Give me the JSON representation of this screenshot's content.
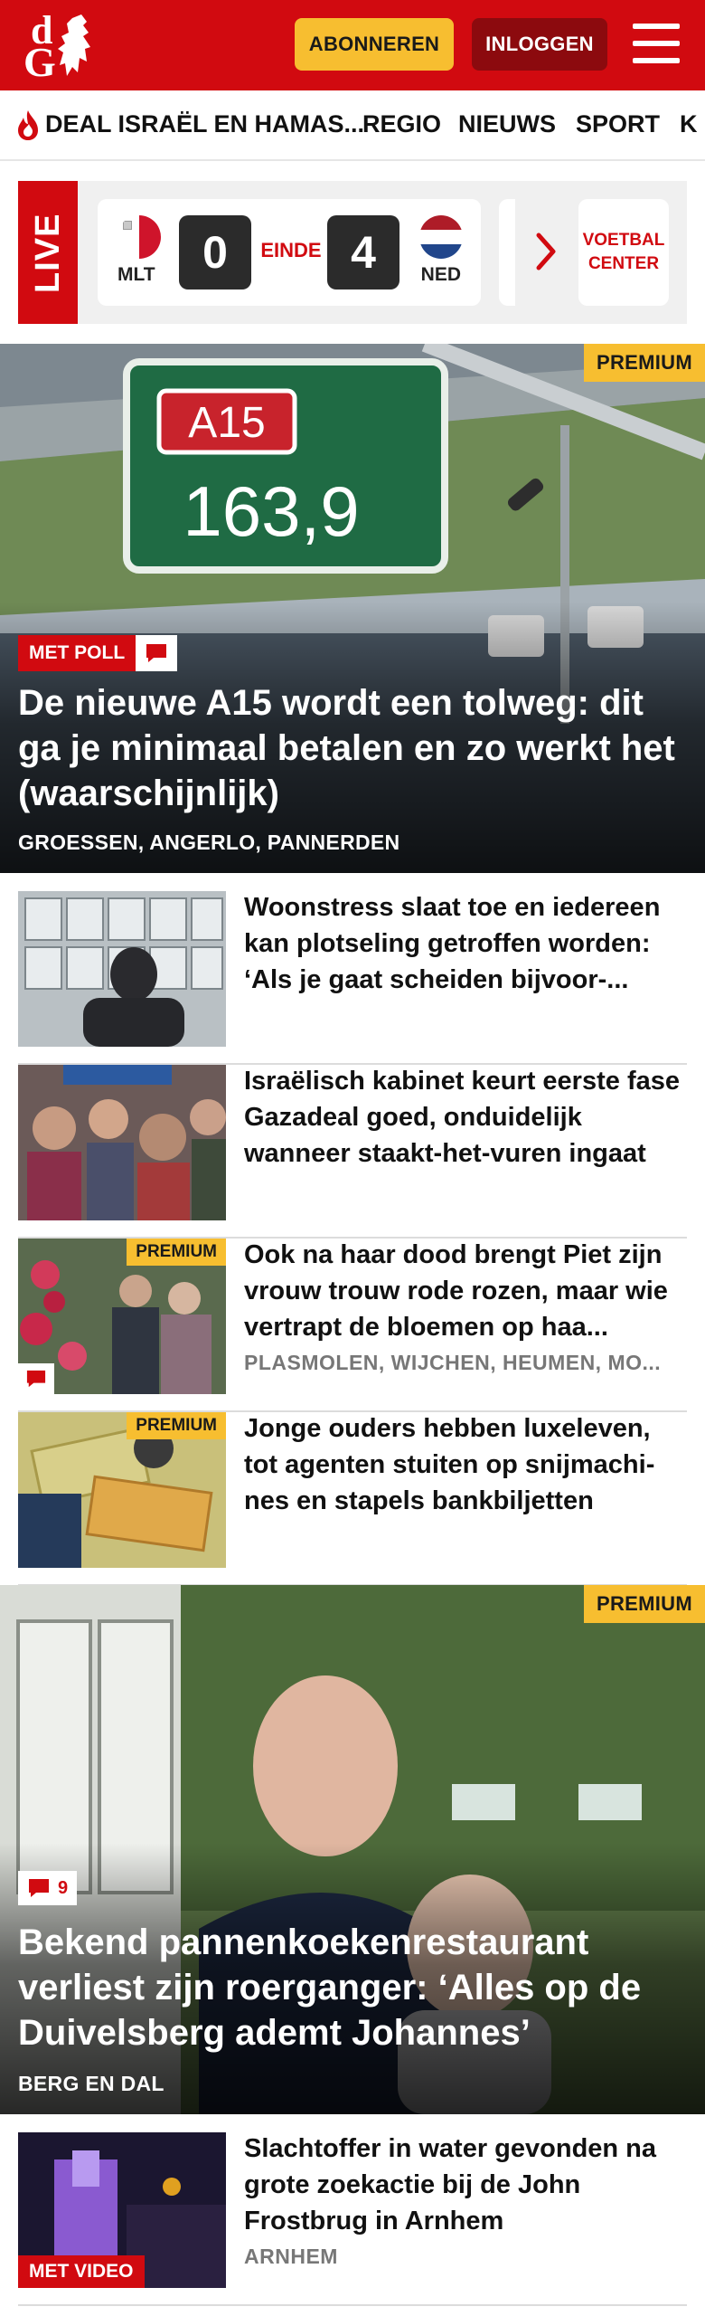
{
  "header": {
    "logo_d": "d",
    "logo_g": "G",
    "subscribe_label": "ABONNEREN",
    "login_label": "INLOGGEN"
  },
  "nav": {
    "items": [
      "DEAL ISRAËL EN HAMAS...",
      "REGIO",
      "NIEUWS",
      "SPORT",
      "K"
    ]
  },
  "live": {
    "label": "LIVE",
    "match": {
      "home_code": "MLT",
      "home_score": "0",
      "status": "EINDE",
      "away_score": "4",
      "away_code": "NED"
    },
    "voetbal_center": "VOETBAL CENTER"
  },
  "hero1": {
    "premium": "PREMIUM",
    "tag": "MET POLL",
    "title": "De nieuwe A15 wordt een tolweg: dit ga je minimaal betalen en zo werkt het (waarschijnlijk)",
    "place": "GROESSEN, ANGERLO, PANNERDEN",
    "sign_road": "A15",
    "sign_km": "163,9"
  },
  "articles": [
    {
      "title": "Woonstress slaat toe en iedereen kan plotseling getroffen worden: ‘Als je gaat scheiden bijvoor-...",
      "place": ""
    },
    {
      "title": "Israëlisch kabinet keurt eerste fase Gazadeal goed, onduidelijk wanneer staakt-het-vuren ingaat",
      "place": ""
    },
    {
      "premium": "PREMIUM",
      "title": "Ook na haar dood brengt Piet zijn vrouw trouw rode rozen, maar wie vertrapt de bloemen op haa...",
      "place": "PLASMOLEN, WIJCHEN, HEUMEN, MO..."
    },
    {
      "premium": "PREMIUM",
      "title": "Jonge ouders hebben luxeleven, tot agenten stuiten op snijmachi-nes en stapels bankbiljetten",
      "place": ""
    }
  ],
  "hero2": {
    "premium": "PREMIUM",
    "comment_count": "9",
    "title": "Bekend pannenkoekenrestaurant verliest zijn roerganger: ‘Alles op de Duivelsberg ademt Johannes’",
    "place": "BERG EN DAL"
  },
  "article_after": {
    "tag": "MET VIDEO",
    "title": "Slachtoffer in water gevonden na grote zoekactie bij de John Frostbrug in Arnhem",
    "place": "ARNHEM"
  },
  "colors": {
    "brand_red": "#d10a10",
    "premium_yellow": "#f7be30",
    "login_dark_red": "#8c0a0e"
  }
}
